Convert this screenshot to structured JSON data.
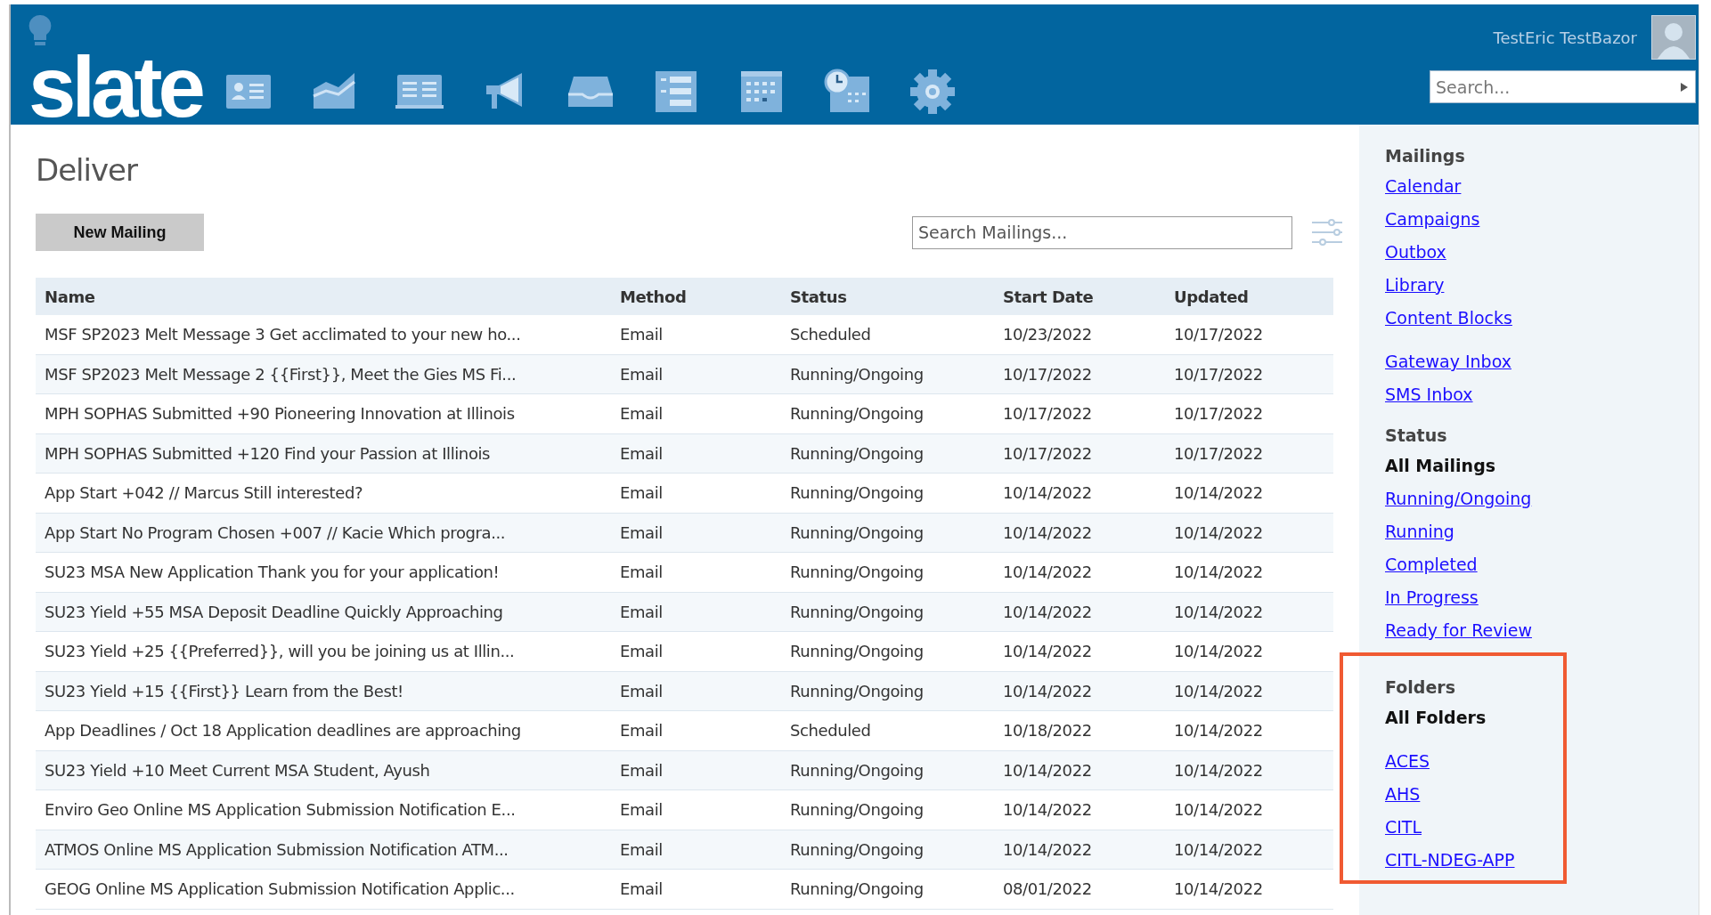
{
  "header": {
    "logo": "slate",
    "user_name": "TestEric TestBazor",
    "search": {
      "placeholder": "Search..."
    }
  },
  "page": {
    "title": "Deliver",
    "new_button": "New Mailing",
    "search": {
      "placeholder": "Search Mailings..."
    }
  },
  "table": {
    "columns": [
      "Name",
      "Method",
      "Status",
      "Start Date",
      "Updated"
    ],
    "rows": [
      [
        "MSF SP2023 Melt Message 3 Get acclimated to your new ho...",
        "Email",
        "Scheduled",
        "10/23/2022",
        "10/17/2022"
      ],
      [
        "MSF SP2023 Melt Message 2 {{First}}, Meet the Gies MS Fi...",
        "Email",
        "Running/Ongoing",
        "10/17/2022",
        "10/17/2022"
      ],
      [
        "MPH SOPHAS Submitted +90 Pioneering Innovation at Illinois",
        "Email",
        "Running/Ongoing",
        "10/17/2022",
        "10/17/2022"
      ],
      [
        "MPH SOPHAS Submitted +120 Find your Passion at Illinois",
        "Email",
        "Running/Ongoing",
        "10/17/2022",
        "10/17/2022"
      ],
      [
        "App Start +042 // Marcus Still interested?",
        "Email",
        "Running/Ongoing",
        "10/14/2022",
        "10/14/2022"
      ],
      [
        "App Start No Program Chosen +007 // Kacie Which progra...",
        "Email",
        "Running/Ongoing",
        "10/14/2022",
        "10/14/2022"
      ],
      [
        "SU23 MSA New Application Thank you for your application!",
        "Email",
        "Running/Ongoing",
        "10/14/2022",
        "10/14/2022"
      ],
      [
        "SU23 Yield +55 MSA Deposit Deadline Quickly Approaching",
        "Email",
        "Running/Ongoing",
        "10/14/2022",
        "10/14/2022"
      ],
      [
        "SU23 Yield +25 {{Preferred}}, will you be joining us at Illin...",
        "Email",
        "Running/Ongoing",
        "10/14/2022",
        "10/14/2022"
      ],
      [
        "SU23 Yield +15 {{First}} Learn from the Best!",
        "Email",
        "Running/Ongoing",
        "10/14/2022",
        "10/14/2022"
      ],
      [
        "App Deadlines / Oct 18 Application deadlines are approaching",
        "Email",
        "Scheduled",
        "10/18/2022",
        "10/14/2022"
      ],
      [
        "SU23 Yield +10 Meet Current MSA Student, Ayush",
        "Email",
        "Running/Ongoing",
        "10/14/2022",
        "10/14/2022"
      ],
      [
        "Enviro Geo Online MS Application Submission Notification E...",
        "Email",
        "Running/Ongoing",
        "10/14/2022",
        "10/14/2022"
      ],
      [
        "ATMOS Online MS Application Submission Notification ATM...",
        "Email",
        "Running/Ongoing",
        "10/14/2022",
        "10/14/2022"
      ],
      [
        "GEOG Online MS Application Submission Notification Applic...",
        "Email",
        "Running/Ongoing",
        "08/01/2022",
        "10/14/2022"
      ]
    ]
  },
  "sidebar": {
    "sections": [
      {
        "title": "Mailings",
        "highlighted": false,
        "groups": [
          [
            {
              "label": "Calendar",
              "selected": false
            },
            {
              "label": "Campaigns",
              "selected": false
            },
            {
              "label": "Outbox",
              "selected": false
            },
            {
              "label": "Library",
              "selected": false
            },
            {
              "label": "Content Blocks",
              "selected": false
            }
          ],
          [
            {
              "label": "Gateway Inbox",
              "selected": false
            },
            {
              "label": "SMS Inbox",
              "selected": false
            }
          ]
        ]
      },
      {
        "title": "Status",
        "highlighted": false,
        "groups": [
          [
            {
              "label": "All Mailings",
              "selected": true
            },
            {
              "label": "Running/Ongoing",
              "selected": false
            },
            {
              "label": "Running",
              "selected": false
            },
            {
              "label": "Completed",
              "selected": false
            },
            {
              "label": "In Progress",
              "selected": false
            },
            {
              "label": "Ready for Review",
              "selected": false
            }
          ]
        ]
      },
      {
        "title": "Folders",
        "highlighted": true,
        "groups": [
          [
            {
              "label": "All Folders",
              "selected": true
            }
          ],
          [
            {
              "label": "ACES",
              "selected": false
            },
            {
              "label": "AHS",
              "selected": false
            },
            {
              "label": "CITL",
              "selected": false
            },
            {
              "label": "CITL-NDEG-APP",
              "selected": false
            }
          ]
        ]
      }
    ]
  }
}
